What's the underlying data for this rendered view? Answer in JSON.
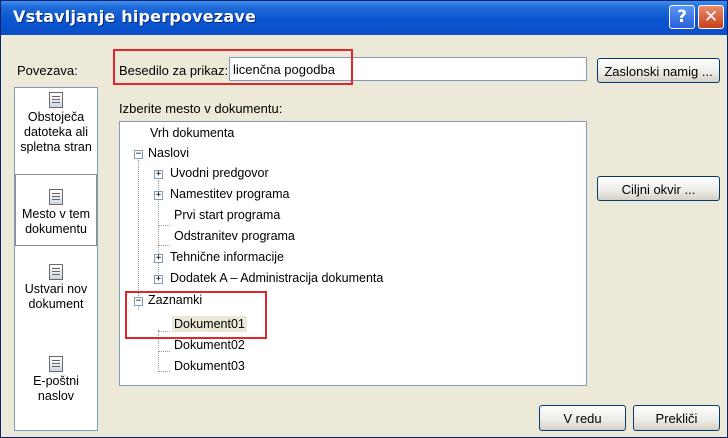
{
  "dialog": {
    "title": "Vstavljanje hiperpovezave",
    "help_glyph": "?",
    "close_glyph": "✕"
  },
  "link_to": {
    "label": "Povezava:",
    "items": [
      {
        "label": "Obstoječa datoteka ali spletna stran",
        "icon": "document-web-icon"
      },
      {
        "label": "Mesto v tem dokumentu",
        "icon": "place-in-document-icon"
      },
      {
        "label": "Ustvari nov dokument",
        "icon": "new-document-icon"
      },
      {
        "label": "E-poštni naslov",
        "icon": "email-icon"
      }
    ]
  },
  "display_text": {
    "label": "Besedilo za prikaz:",
    "value": "licenčna pogodba"
  },
  "screen_tip_button": "Zaslonski namig ...",
  "target_frame_button": "Ciljni okvir ...",
  "select_place_label": "Izberite mesto v dokumentu:",
  "tree": {
    "top": "Vrh dokumenta",
    "headings": {
      "label": "Naslovi",
      "children": [
        "Uvodni predgovor",
        "Namestitev programa",
        "Prvi start programa",
        "Odstranitev programa",
        "Tehnične informacije",
        "Dodatek A – Administracija dokumenta"
      ]
    },
    "bookmarks": {
      "label": "Zaznamki",
      "children": [
        "Dokument01",
        "Dokument02",
        "Dokument03"
      ]
    }
  },
  "ok_button": "V redu",
  "cancel_button": "Prekliči",
  "colors": {
    "highlight": "#e3262b",
    "titlebar": "#0b55d2"
  }
}
